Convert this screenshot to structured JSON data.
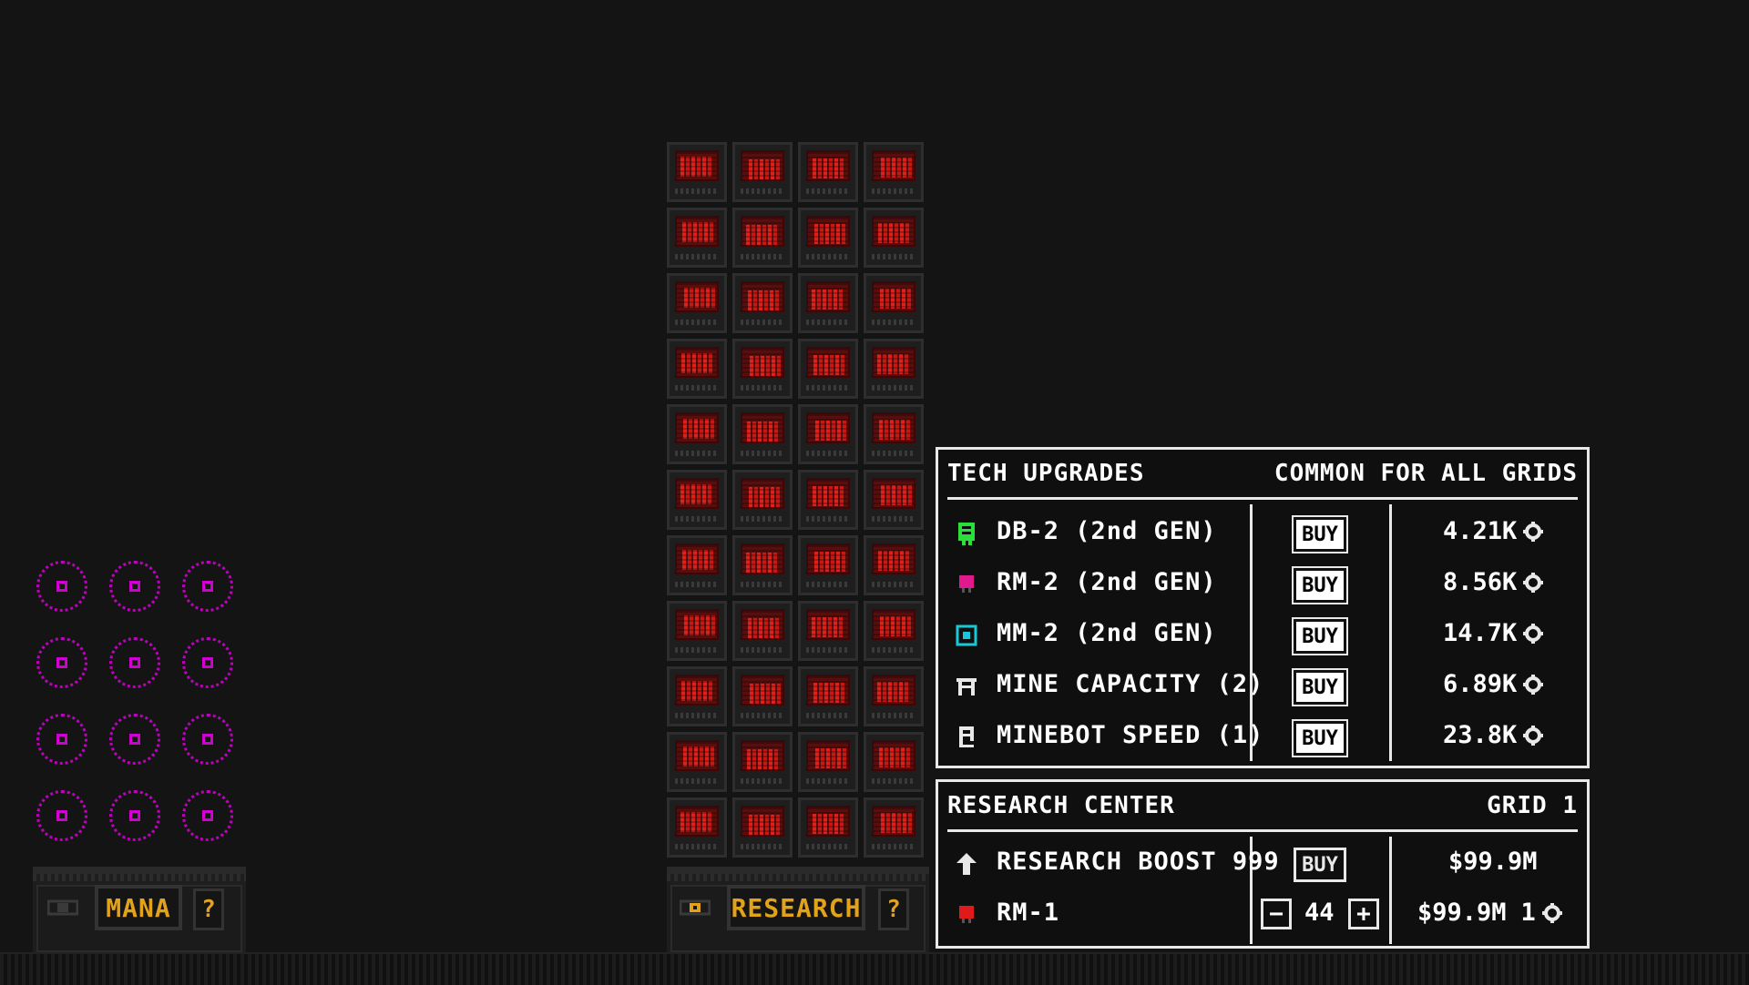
{
  "mana_grid": {
    "label": "MANA",
    "help": "?",
    "nodes": 12
  },
  "research_grid": {
    "label": "RESEARCH",
    "help": "?",
    "servers": 44
  },
  "tech_upgrades": {
    "title": "TECH UPGRADES",
    "scope": "COMMON FOR ALL GRIDS",
    "items": [
      {
        "icon": "db-chip-icon",
        "icon_color": "#29e03a",
        "name": "DB-2 (2nd GEN)",
        "buy": "BUY",
        "cost": "4.21K"
      },
      {
        "icon": "rm-chip-icon",
        "icon_color": "#e01a8c",
        "name": "RM-2 (2nd GEN)",
        "buy": "BUY",
        "cost": "8.56K"
      },
      {
        "icon": "mm-chip-icon",
        "icon_color": "#19c8d8",
        "name": "MM-2 (2nd GEN)",
        "buy": "BUY",
        "cost": "14.7K"
      },
      {
        "icon": "mine-capacity-icon",
        "icon_color": "#e8e8e8",
        "name": "MINE CAPACITY (2)",
        "buy": "BUY",
        "cost": "6.89K"
      },
      {
        "icon": "minebot-speed-icon",
        "icon_color": "#e8e8e8",
        "name": "MINEBOT SPEED (1)",
        "buy": "BUY",
        "cost": "23.8K"
      }
    ]
  },
  "research_center": {
    "title": "RESEARCH CENTER",
    "grid": "GRID 1",
    "boost": {
      "icon": "arrow-up-icon",
      "name": "RESEARCH BOOST 999",
      "buy": "BUY",
      "cost": "$99.9M"
    },
    "rm1": {
      "icon": "rm1-chip-icon",
      "icon_color": "#e01a1a",
      "name": "RM-1",
      "minus": "−",
      "count": "44",
      "plus": "+",
      "cost": "$99.9M",
      "level": "1"
    }
  },
  "colors": {
    "accent": "#e2a21a",
    "mana": "#c000c0",
    "server_red": "#e0201a"
  }
}
